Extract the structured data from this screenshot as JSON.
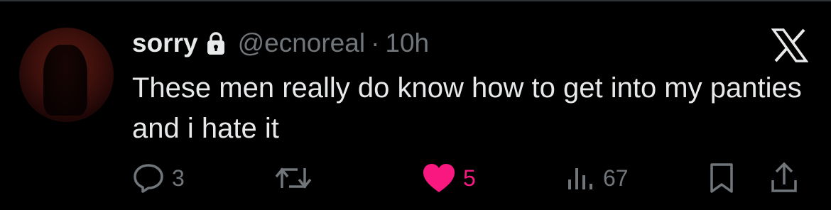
{
  "tweet": {
    "display_name": "sorry",
    "handle": "@ecnoreal",
    "separator": "·",
    "time": "10h",
    "text": "These men really do know how to get into my panties and i hate it"
  },
  "actions": {
    "reply_count": "3",
    "like_count": "5",
    "view_count": "67"
  },
  "icons": {
    "reply": "reply-icon",
    "retweet": "retweet-icon",
    "like": "heart-icon",
    "views": "views-icon",
    "bookmark": "bookmark-icon",
    "share": "share-icon",
    "brand": "x-logo-icon",
    "lock": "lock-icon"
  },
  "colors": {
    "background": "#000000",
    "primary_text": "#e7e9ea",
    "secondary_text": "#71767b",
    "like_active": "#f91880"
  }
}
